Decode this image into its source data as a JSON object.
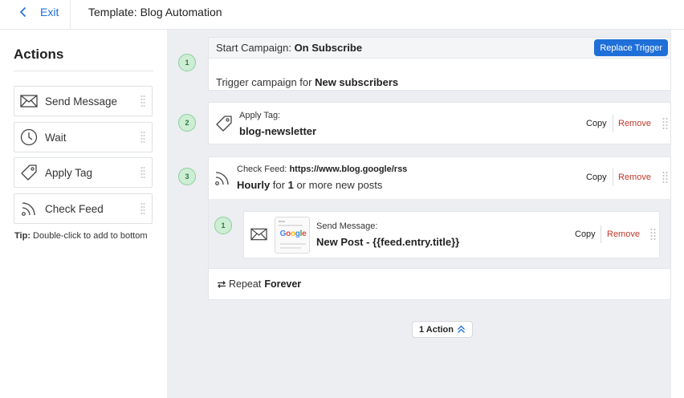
{
  "header": {
    "exit_label": "Exit",
    "template_title": "Template: Blog Automation"
  },
  "sidebar": {
    "heading": "Actions",
    "items": [
      {
        "label": "Send Message",
        "icon": "envelope-icon"
      },
      {
        "label": "Wait",
        "icon": "clock-icon"
      },
      {
        "label": "Apply Tag",
        "icon": "tag-icon"
      },
      {
        "label": "Check Feed",
        "icon": "rss-icon"
      }
    ],
    "tip_label": "Tip:",
    "tip_text": "Double-click to add to bottom"
  },
  "flow": {
    "start": {
      "number": "1",
      "label_prefix": "Start Campaign:",
      "label_value": "On Subscribe",
      "replace_label": "Replace Trigger",
      "body_prefix": "Trigger campaign for",
      "body_value": "New subscribers"
    },
    "step2": {
      "number": "2",
      "icon": "tag-icon",
      "small_label": "Apply Tag:",
      "value": "blog-newsletter",
      "copy_label": "Copy",
      "remove_label": "Remove"
    },
    "step3": {
      "number": "3",
      "icon": "rss-icon",
      "small_prefix": "Check Feed:",
      "feed_url": "https://www.blog.google/rss",
      "freq": "Hourly",
      "for_text": "for",
      "count": "1",
      "more_text": "or more new posts",
      "copy_label": "Copy",
      "remove_label": "Remove"
    },
    "nested": {
      "number": "1",
      "icon": "envelope-icon",
      "thumb_logo": "Google",
      "small_label": "Send Message:",
      "value": "New Post - {{feed.entry.title}}",
      "copy_label": "Copy",
      "remove_label": "Remove"
    },
    "repeat": {
      "prefix": "Repeat",
      "value": "Forever",
      "pill_label": "1 Action"
    }
  },
  "colors": {
    "accent": "#1f6fd8",
    "remove": "#c0392b",
    "step_badge_bg": "#cdeed4",
    "canvas_bg": "#eceef2"
  }
}
